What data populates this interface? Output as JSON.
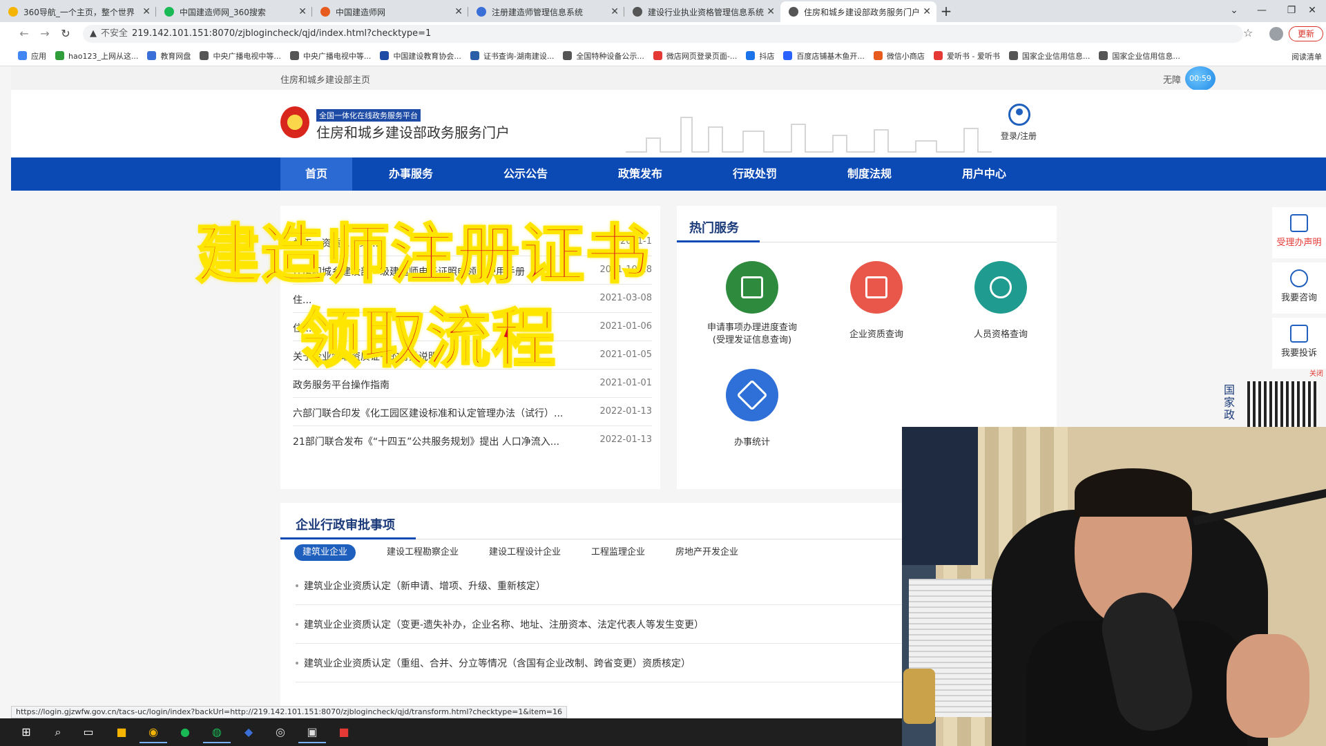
{
  "browser": {
    "tabs": [
      {
        "title": "360导航_一个主页，整个世界",
        "icon_color": "#f5b400",
        "active": false
      },
      {
        "title": "中国建造师网_360搜索",
        "icon_color": "#19b955",
        "active": false
      },
      {
        "title": "中国建造师网",
        "icon_color": "#e85b1e",
        "active": false
      },
      {
        "title": "注册建造师管理信息系统",
        "icon_color": "#3a6fd8",
        "active": false
      },
      {
        "title": "建设行业执业资格管理信息系统",
        "icon_color": "#555555",
        "active": false
      },
      {
        "title": "住房和城乡建设部政务服务门户",
        "icon_color": "#555555",
        "active": true
      }
    ],
    "security_label": "不安全",
    "url": "219.142.101.151:8070/zjblogincheck/qjd/index.html?checktype=1",
    "update_label": "更新",
    "bookmarks": [
      {
        "label": "应用",
        "color": "#4285f4"
      },
      {
        "label": "hao123_上网从这...",
        "color": "#2e9d3a"
      },
      {
        "label": "教育网盘",
        "color": "#3a6fd8"
      },
      {
        "label": "中央广播电视中等...",
        "color": "#555555"
      },
      {
        "label": "中央广播电视中等...",
        "color": "#555555"
      },
      {
        "label": "中国建设教育协会...",
        "color": "#1d4ba6"
      },
      {
        "label": "证书查询-湖南建设...",
        "color": "#2b5fa8"
      },
      {
        "label": "全国特种设备公示...",
        "color": "#555555"
      },
      {
        "label": "微店网页登录页面-...",
        "color": "#e53935"
      },
      {
        "label": "抖店",
        "color": "#1a73e8"
      },
      {
        "label": "百度店铺基木鱼开...",
        "color": "#2962ff"
      },
      {
        "label": "微信小商店",
        "color": "#e85b1e"
      },
      {
        "label": "爱听书 - 爱听书",
        "color": "#e53935"
      },
      {
        "label": "国家企业信用信息...",
        "color": "#555555"
      },
      {
        "label": "国家企业信用信息...",
        "color": "#555555"
      }
    ],
    "reading_list": "阅读清单",
    "status_url": "https://login.gjzwfw.gov.cn/tacs-uc/login/index?backUrl=http://219.142.101.151:8070/zjblogincheck/qjd/transform.html?checktype=1&item=16"
  },
  "site": {
    "top_link": "住房和城乡建设部主页",
    "accessibility": "无障",
    "timer": "00:59",
    "platform_badge": "全国一体化在线政务服务平台",
    "portal_title": "住房和城乡建设部政务服务门户",
    "login_label": "登录/注册",
    "nav": [
      "首页",
      "办事服务",
      "公示公告",
      "政策发布",
      "行政处罚",
      "制度法规",
      "用户中心"
    ],
    "news": [
      {
        "title": "关于...资质...延续...",
        "date": "2021-1"
      },
      {
        "title": "住房和城乡建设部一级建造师电子证照申领及使用手册",
        "date": "2021-10-18"
      },
      {
        "title": "住...",
        "date": "2021-03-08"
      },
      {
        "title": "住...",
        "date": "2021-01-06"
      },
      {
        "title": "关于企业领取资质证书的有关说明",
        "date": "2021-01-05"
      },
      {
        "title": "政务服务平台操作指南",
        "date": "2021-01-01"
      },
      {
        "title": "六部门联合印发《化工园区建设标准和认定管理办法（试行）...",
        "date": "2022-01-13"
      },
      {
        "title": "21部门联合发布《“十四五”公共服务规划》提出 人口净流入...",
        "date": "2022-01-13"
      }
    ],
    "hot_title": "热门服务",
    "services": [
      {
        "label": "申请事项办理进度查询",
        "sub": "(受理发证信息查询)",
        "color": "#2e8b3e"
      },
      {
        "label": "企业资质查询",
        "sub": "",
        "color": "#e9574a"
      },
      {
        "label": "人员资格查询",
        "sub": "",
        "color": "#1f9b8f"
      },
      {
        "label": "办事统计",
        "sub": "",
        "color": "#2f6fd8"
      }
    ],
    "admin_title": "企业行政审批事项",
    "admin_tabs": [
      "建筑业企业",
      "建设工程勘察企业",
      "建设工程设计企业",
      "工程监理企业",
      "房地产开发企业"
    ],
    "admin_items": [
      "建筑业企业资质认定（新申请、增项、升级、重新核定）",
      "建筑业企业资质认定（变更-遗失补办，企业名称、地址、注册资本、法定代表人等发生变更）",
      "建筑业企业资质认定（重组、合并、分立等情况（含国有企业改制、跨省变更）资质核定）"
    ],
    "float_buttons": [
      "受理办声明",
      "我要咨询",
      "我要投诉"
    ],
    "float_close": "关闭",
    "qr_side": "国家政"
  },
  "overlay": {
    "line1": "建造师注册证书",
    "line2": "领取流程"
  }
}
